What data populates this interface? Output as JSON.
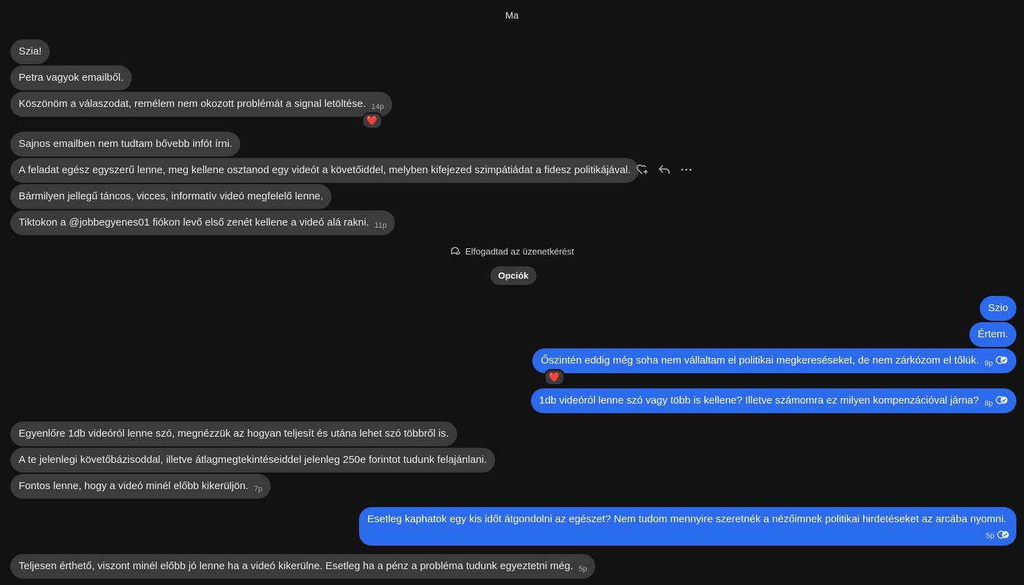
{
  "conversation": {
    "day_label": "Ma",
    "incoming_1": {
      "m1": "Szia!",
      "m2": "Petra vagyok emailből.",
      "m3": "Köszönöm a válaszodat, remélem nem okozott problémát a signal letöltése.",
      "m3_time": "14p",
      "m3_reaction": "❤️",
      "m4": "Sajnos emailben nem tudtam bővebb infót írni.",
      "m5": "A feladat egész egyszerű lenne, meg kellene osztanod egy videót a követőiddel, melyben kifejezed szimpátiádat a fidesz politikájával.",
      "m6": "Bármilyen jellegű táncos, vicces, informatív videó megfelelő lenne.",
      "m7": "Tiktokon a @jobbegyenes01 fiókon levő első zenét kellene a videó alá rakni.",
      "m7_time": "11p"
    },
    "hover_actions": [
      "add-reaction-icon",
      "reply-icon",
      "more-icon"
    ],
    "request_notice": "Elfogadtad az üzenetkérést",
    "options_button": "Opciók",
    "outgoing_1": {
      "m1": "Szio",
      "m2": "Értem.",
      "m3": "Őszintén eddig még soha nem vállaltam el politikai megkereséseket, de nem zárkózom el tőlük.",
      "m3_time": "9p",
      "m3_reaction": "❤️",
      "m4": "1db videóról lenne szó vagy több is kellene? Illetve számomra ez milyen kompenzációval járna?",
      "m4_time": "8p"
    },
    "incoming_2": {
      "m1": "Egyenlőre 1db videóról lenne szó, megnézzük az hogyan teljesít és utána lehet szó többről is.",
      "m2": "A te jelenlegi követőbázisoddal, illetve átlagmegtekintéseiddel jelenleg 250e forintot tudunk felajánlani.",
      "m3": "Fontos lenne, hogy a videó minél előbb kikerüljön.",
      "m3_time": "7p"
    },
    "outgoing_2": {
      "m1": "Esetleg kaphatok egy kis időt átgondolni az egészet? Nem tudom mennyire szeretnék a nézőimnek politikai hirdetéseket az arcába nyomni.",
      "m1_time": "5p"
    },
    "incoming_3": {
      "m1": "Teljesen érthető, viszont minél előbb jó lenne ha a videó kikerülne. Esetleg ha a pénz a probléma tudunk egyeztetni még.",
      "m1_time": "5p"
    },
    "colors": {
      "background": "#121212",
      "incoming_bubble": "#3b3b3b",
      "outgoing_bubble": "#2c6bed"
    }
  }
}
